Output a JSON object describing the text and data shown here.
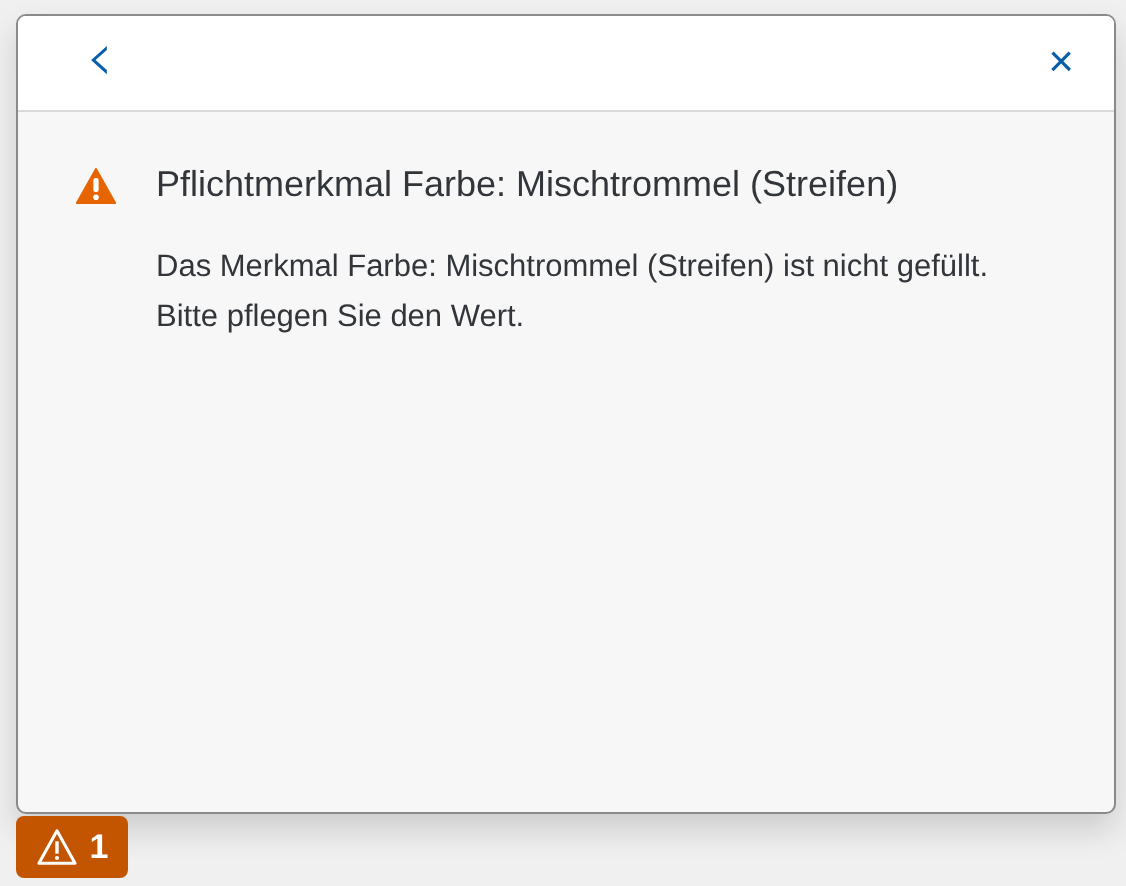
{
  "popover": {
    "back_button": "‹",
    "close_button": "×"
  },
  "messages": [
    {
      "kind": "warning",
      "title": "Pflichtmerkmal Farbe: Mischtrommel (Streifen)",
      "description": "Das Merkmal Farbe: Mischtrommel (Streifen) ist nicht gefüllt. Bitte pflegen Sie den Wert."
    }
  ],
  "message_button": {
    "kind": "warning",
    "count": "1"
  }
}
